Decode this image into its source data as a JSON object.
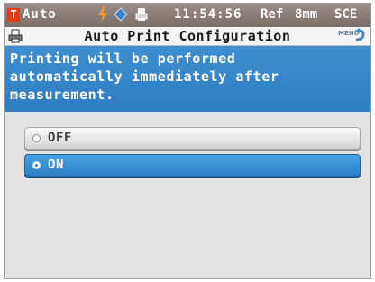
{
  "status_bar": {
    "mode": "Auto",
    "mode_icon_letter": "T",
    "time": "11:54:56",
    "reference": "Ref",
    "aperture": "8mm",
    "specular": "SCE",
    "icons": [
      "power-bolt-icon",
      "target-drop-icon",
      "printer-small-icon"
    ]
  },
  "title_bar": {
    "title": "Auto Print Configuration",
    "menu_label": "MENU",
    "icons": [
      "printer-icon",
      "menu-return-icon"
    ]
  },
  "message": {
    "text": "Printing will be performed\nautomatically immediately after\nmeasurement."
  },
  "options": [
    {
      "label": "OFF",
      "selected": false
    },
    {
      "label": "ON",
      "selected": true
    }
  ],
  "colors": {
    "highlight_blue": "#2f7cc1",
    "status_bar": "#8a7d78",
    "mode_icon": "#e63a14"
  }
}
